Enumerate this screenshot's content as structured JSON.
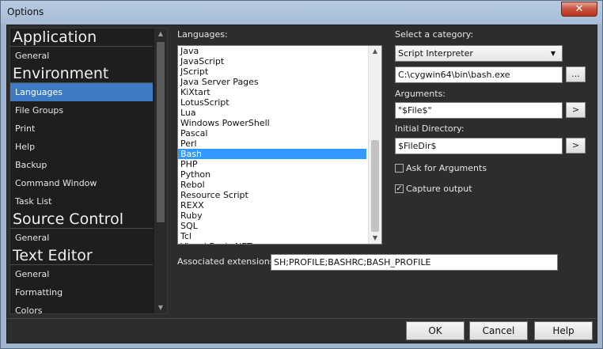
{
  "window": {
    "title": "Options",
    "close_glyph": "✕"
  },
  "sidebar": {
    "groups": [
      {
        "header": "Application",
        "items": [
          {
            "label": "General",
            "selected": false
          }
        ]
      },
      {
        "header": "Environment",
        "items": [
          {
            "label": "Languages",
            "selected": true
          },
          {
            "label": "File Groups",
            "selected": false
          },
          {
            "label": "Print",
            "selected": false
          },
          {
            "label": "Help",
            "selected": false
          },
          {
            "label": "Backup",
            "selected": false
          },
          {
            "label": "Command Window",
            "selected": false
          },
          {
            "label": "Task List",
            "selected": false
          }
        ]
      },
      {
        "header": "Source Control",
        "items": [
          {
            "label": "General",
            "selected": false
          }
        ]
      },
      {
        "header": "Text Editor",
        "items": [
          {
            "label": "General",
            "selected": false
          },
          {
            "label": "Formatting",
            "selected": false
          },
          {
            "label": "Colors",
            "selected": false
          }
        ]
      }
    ]
  },
  "languages": {
    "label": "Languages:",
    "items": [
      "Java",
      "JavaScript",
      "JScript",
      "Java Server Pages",
      "KiXtart",
      "LotusScript",
      "Lua",
      "Windows PowerShell",
      "Pascal",
      "Perl",
      "Bash",
      "PHP",
      "Python",
      "Rebol",
      "Resource Script",
      "REXX",
      "Ruby",
      "SQL",
      "Tcl",
      "Visual Basic.NET"
    ],
    "selected": "Bash"
  },
  "category": {
    "label": "Select a category:",
    "value": "Script Interpreter",
    "dropdown_glyph": "▼",
    "path": "C:\\cygwin64\\bin\\bash.exe",
    "browse_label": "...",
    "arguments_label": "Arguments:",
    "arguments_value": "\"$File$\"",
    "arguments_button": ">",
    "initdir_label": "Initial Directory:",
    "initdir_value": "$FileDir$",
    "initdir_button": ">",
    "ask_arguments_label": "Ask for Arguments",
    "ask_arguments_checked": false,
    "capture_output_label": "Capture output",
    "capture_output_checked": true,
    "check_glyph": "✓"
  },
  "extensions": {
    "label": "Associated extensions:",
    "value": "SH;PROFILE;BASHRC;BASH_PROFILE"
  },
  "footer": {
    "ok": "OK",
    "cancel": "Cancel",
    "help": "Help"
  },
  "scroll": {
    "up": "▲",
    "down": "▼"
  }
}
